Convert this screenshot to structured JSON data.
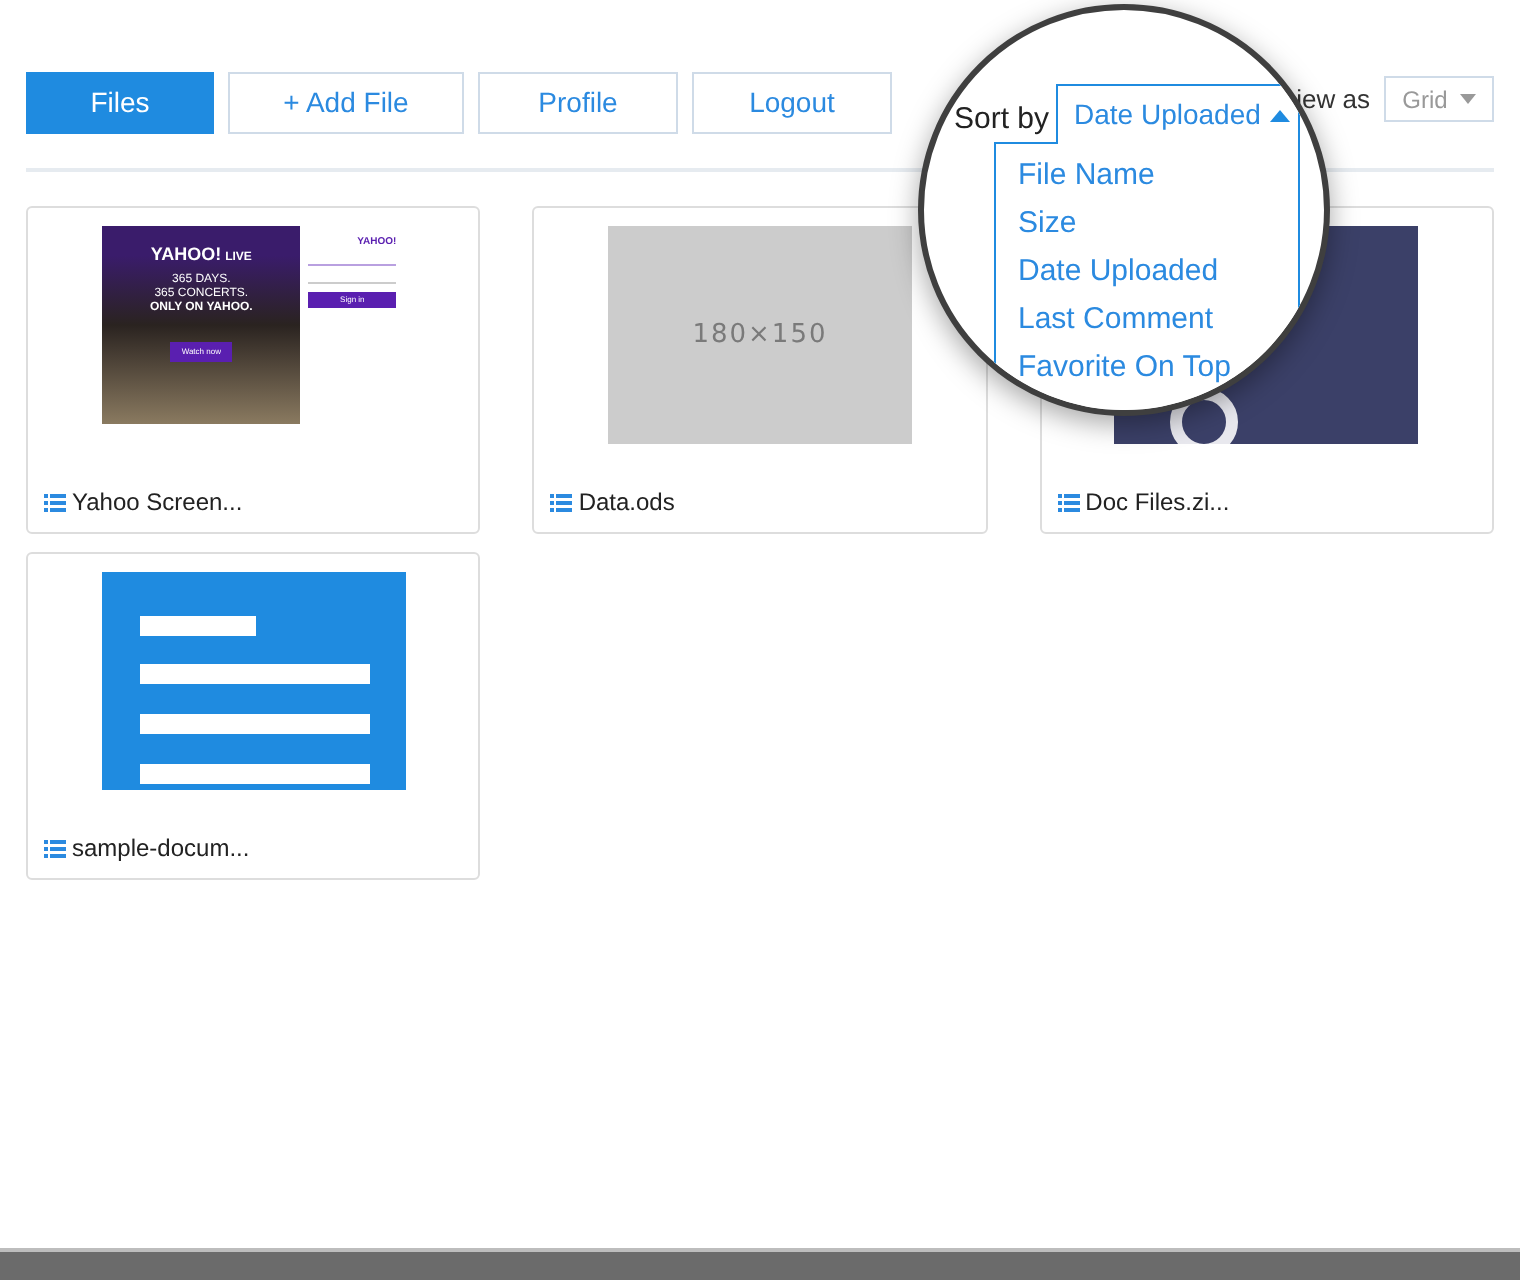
{
  "nav": [
    {
      "label": "Files",
      "selected": true
    },
    {
      "label": "+ Add File",
      "selected": false
    },
    {
      "label": "Profile",
      "selected": false
    },
    {
      "label": "Logout",
      "selected": false
    }
  ],
  "sort": {
    "label": "Sort by",
    "value": "Date Uploaded",
    "expanded": true,
    "options": [
      "File Name",
      "Size",
      "Date Uploaded",
      "Last Comment",
      "Favorite On Top"
    ]
  },
  "view": {
    "label": "iew as",
    "value": "Grid"
  },
  "files": [
    {
      "name": "Yahoo Screen...",
      "kind": "screenshot",
      "thumbnail": {
        "brand": "YAHOO!",
        "brand_suffix": "LIVE",
        "lines": [
          "365 DAYS.",
          "365 CONCERTS."
        ],
        "headline": "ONLY ON YAHOO.",
        "button": "Watch now",
        "form_logo": "YAHOO!",
        "form_button": "Sign in"
      }
    },
    {
      "name": "Data.ods",
      "kind": "placeholder",
      "thumbnail": {
        "text": "180×150"
      }
    },
    {
      "name": "Doc Files.zi..."
    },
    {
      "name": "sample-docum...",
      "kind": "document"
    }
  ]
}
